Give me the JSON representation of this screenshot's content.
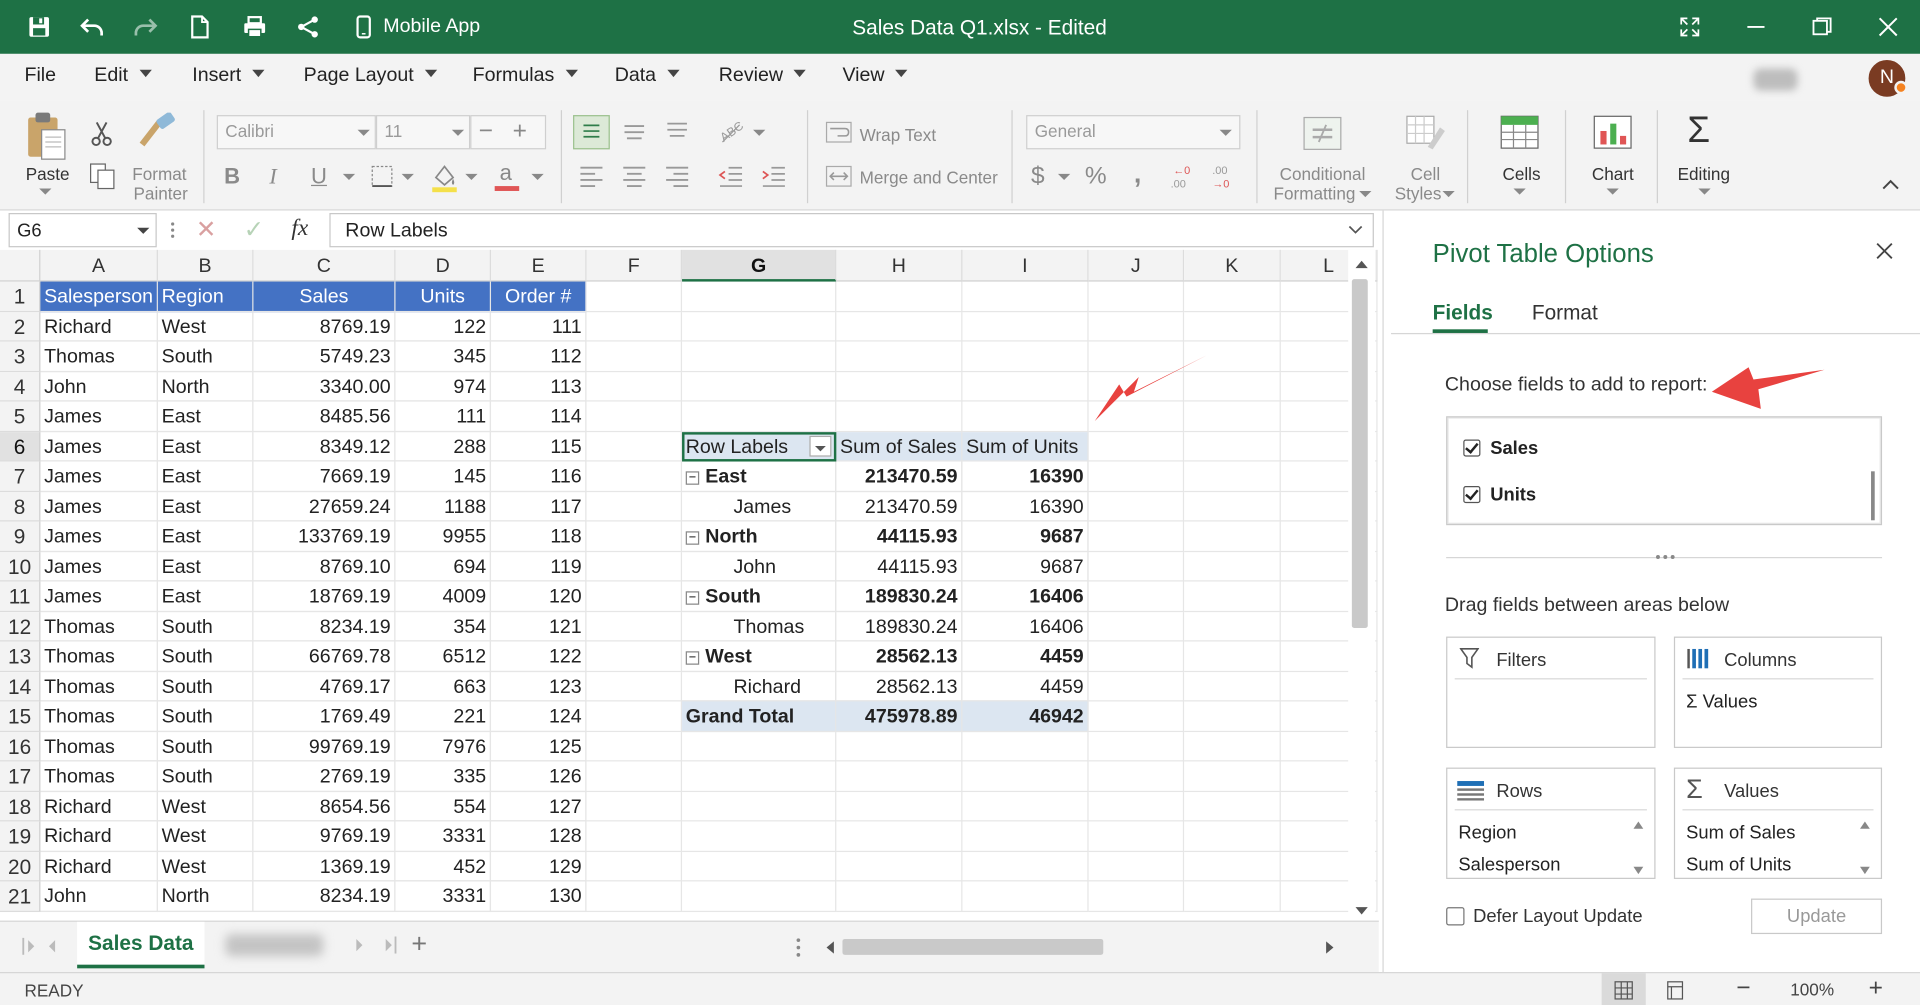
{
  "titlebar": {
    "mobile_app": "Mobile App",
    "doc_title": "Sales Data Q1.xlsx - Edited",
    "bg_color": "#1e7145"
  },
  "menu": [
    "File",
    "Edit",
    "Insert",
    "Page Layout",
    "Formulas",
    "Data",
    "Review",
    "View"
  ],
  "user": {
    "initial": "N"
  },
  "ribbon": {
    "paste": "Paste",
    "format_painter_1": "Format",
    "format_painter_2": "Painter",
    "font_name": "Calibri",
    "font_size": "11",
    "wrap_text": "Wrap Text",
    "merge_center": "Merge and Center",
    "number_format": "General",
    "cond_fmt_1": "Conditional",
    "cond_fmt_2": "Formatting",
    "cell_styles_1": "Cell",
    "cell_styles_2": "Styles",
    "cells": "Cells",
    "chart": "Chart",
    "editing": "Editing",
    "bold": "B",
    "italic": "I",
    "underline": "U",
    "percent": "%",
    "comma": ",",
    "sigma": "Σ"
  },
  "formula_bar": {
    "name_box": "G6",
    "fx": "fx",
    "value": "Row Labels"
  },
  "columns": [
    "A",
    "B",
    "C",
    "D",
    "E",
    "F",
    "G",
    "H",
    "I",
    "J",
    "K",
    "L"
  ],
  "selected_column": "G",
  "rows": [
    "1",
    "2",
    "3",
    "4",
    "5",
    "6",
    "7",
    "8",
    "9",
    "10",
    "11",
    "12",
    "13",
    "14",
    "15",
    "16",
    "17",
    "18",
    "19",
    "20",
    "21"
  ],
  "selected_row": "6",
  "table": {
    "headers": [
      "Salesperson",
      "Region",
      "Sales",
      "Units",
      "Order #"
    ],
    "data": [
      [
        "Richard",
        "West",
        "8769.19",
        "122",
        "111"
      ],
      [
        "Thomas",
        "South",
        "5749.23",
        "345",
        "112"
      ],
      [
        "John",
        "North",
        "3340.00",
        "974",
        "113"
      ],
      [
        "James",
        "East",
        "8485.56",
        "111",
        "114"
      ],
      [
        "James",
        "East",
        "8349.12",
        "288",
        "115"
      ],
      [
        "James",
        "East",
        "7669.19",
        "145",
        "116"
      ],
      [
        "James",
        "East",
        "27659.24",
        "1188",
        "117"
      ],
      [
        "James",
        "East",
        "133769.19",
        "9955",
        "118"
      ],
      [
        "James",
        "East",
        "8769.10",
        "694",
        "119"
      ],
      [
        "James",
        "East",
        "18769.19",
        "4009",
        "120"
      ],
      [
        "Thomas",
        "South",
        "8234.19",
        "354",
        "121"
      ],
      [
        "Thomas",
        "South",
        "66769.78",
        "6512",
        "122"
      ],
      [
        "Thomas",
        "South",
        "4769.17",
        "663",
        "123"
      ],
      [
        "Thomas",
        "South",
        "1769.49",
        "221",
        "124"
      ],
      [
        "Thomas",
        "South",
        "99769.19",
        "7976",
        "125"
      ],
      [
        "Thomas",
        "South",
        "2769.19",
        "335",
        "126"
      ],
      [
        "Richard",
        "West",
        "8654.56",
        "554",
        "127"
      ],
      [
        "Richard",
        "West",
        "9769.19",
        "3331",
        "128"
      ],
      [
        "Richard",
        "West",
        "1369.19",
        "452",
        "129"
      ],
      [
        "John",
        "North",
        "8234.19",
        "3331",
        "130"
      ]
    ]
  },
  "pivot": {
    "headers": [
      "Row Labels",
      "Sum of Sales",
      "Sum of Units"
    ],
    "rows": [
      {
        "label": "East",
        "sales": "213470.59",
        "units": "16390",
        "level": 0
      },
      {
        "label": "James",
        "sales": "213470.59",
        "units": "16390",
        "level": 1
      },
      {
        "label": "North",
        "sales": "44115.93",
        "units": "9687",
        "level": 0
      },
      {
        "label": "John",
        "sales": "44115.93",
        "units": "9687",
        "level": 1
      },
      {
        "label": "South",
        "sales": "189830.24",
        "units": "16406",
        "level": 0
      },
      {
        "label": "Thomas",
        "sales": "189830.24",
        "units": "16406",
        "level": 1
      },
      {
        "label": "West",
        "sales": "28562.13",
        "units": "4459",
        "level": 0
      },
      {
        "label": "Richard",
        "sales": "28562.13",
        "units": "4459",
        "level": 1
      }
    ],
    "total": {
      "label": "Grand Total",
      "sales": "475978.89",
      "units": "46942"
    }
  },
  "sheet_tabs": {
    "active": "Sales Data"
  },
  "status": {
    "ready": "READY",
    "zoom": "100%"
  },
  "pane": {
    "title": "Pivot Table Options",
    "tabs": [
      "Fields",
      "Format"
    ],
    "choose_label": "Choose fields to add to report:",
    "fields": [
      {
        "name": "Sales",
        "checked": true
      },
      {
        "name": "Units",
        "checked": true
      }
    ],
    "drag_label": "Drag fields between areas below",
    "filters": "Filters",
    "columns": "Columns",
    "columns_items": [
      "Σ Values"
    ],
    "rows": "Rows",
    "rows_items": [
      "Region",
      "Salesperson"
    ],
    "values": "Values",
    "values_items": [
      "Sum of Sales",
      "Sum of Units"
    ],
    "defer": "Defer Layout Update",
    "update": "Update",
    "accent": "#1e7145",
    "arrow_color": "#e8423f"
  }
}
